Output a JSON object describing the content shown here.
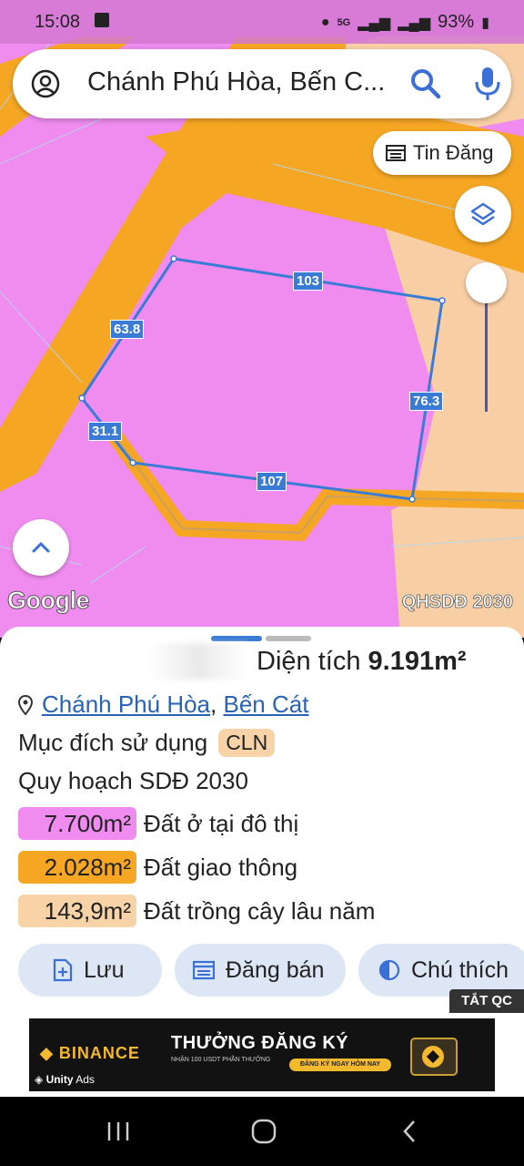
{
  "status_bar": {
    "time": "15:08",
    "battery": "93%",
    "network": "5G"
  },
  "search": {
    "query": "Chánh Phú Hòa, Bến C..."
  },
  "map": {
    "tin_dang_label": "Tin Đăng",
    "google_label": "Google",
    "layer_label": "QHSDĐ 2030",
    "edge_labels": {
      "top": "103",
      "left_upper": "63.8",
      "right": "76.3",
      "left_lower": "31.1",
      "bottom": "107"
    },
    "colors": {
      "residential": "#f08cf0",
      "traffic": "#f5a623",
      "perennial": "#f8cfa4",
      "boundary": "#3a7bd5"
    }
  },
  "sheet": {
    "area_label": "Diện tích",
    "area_value": "9.191m²",
    "location_ward": "Chánh Phú Hòa",
    "location_sep": ",",
    "location_town": "Bến Cát",
    "purpose_label": "Mục đích sử dụng",
    "purpose_code": "CLN",
    "plan_label": "Quy hoạch SDĐ 2030",
    "zones": [
      {
        "value": "7.700m²",
        "label": "Đất ở tại đô thị",
        "color": "#f08cf0"
      },
      {
        "value": "2.028m²",
        "label": "Đất giao thông",
        "color": "#f5a623"
      },
      {
        "value": "143,9m²",
        "label": "Đất trồng cây lâu năm",
        "color": "#f8d3a8"
      }
    ],
    "actions": {
      "save": "Lưu",
      "post": "Đăng bán",
      "legend": "Chú thích"
    }
  },
  "ad": {
    "close_label": "TẮT QC",
    "brand": "BINANCE",
    "headline": "THƯỞNG ĐĂNG KÝ",
    "subline": "NHẬN 100 USDT PHẦN THƯỞNG",
    "cta": "ĐĂNG KÝ NGAY HÔM NAY",
    "network_brand": "Unity",
    "network_suffix": "Ads"
  }
}
